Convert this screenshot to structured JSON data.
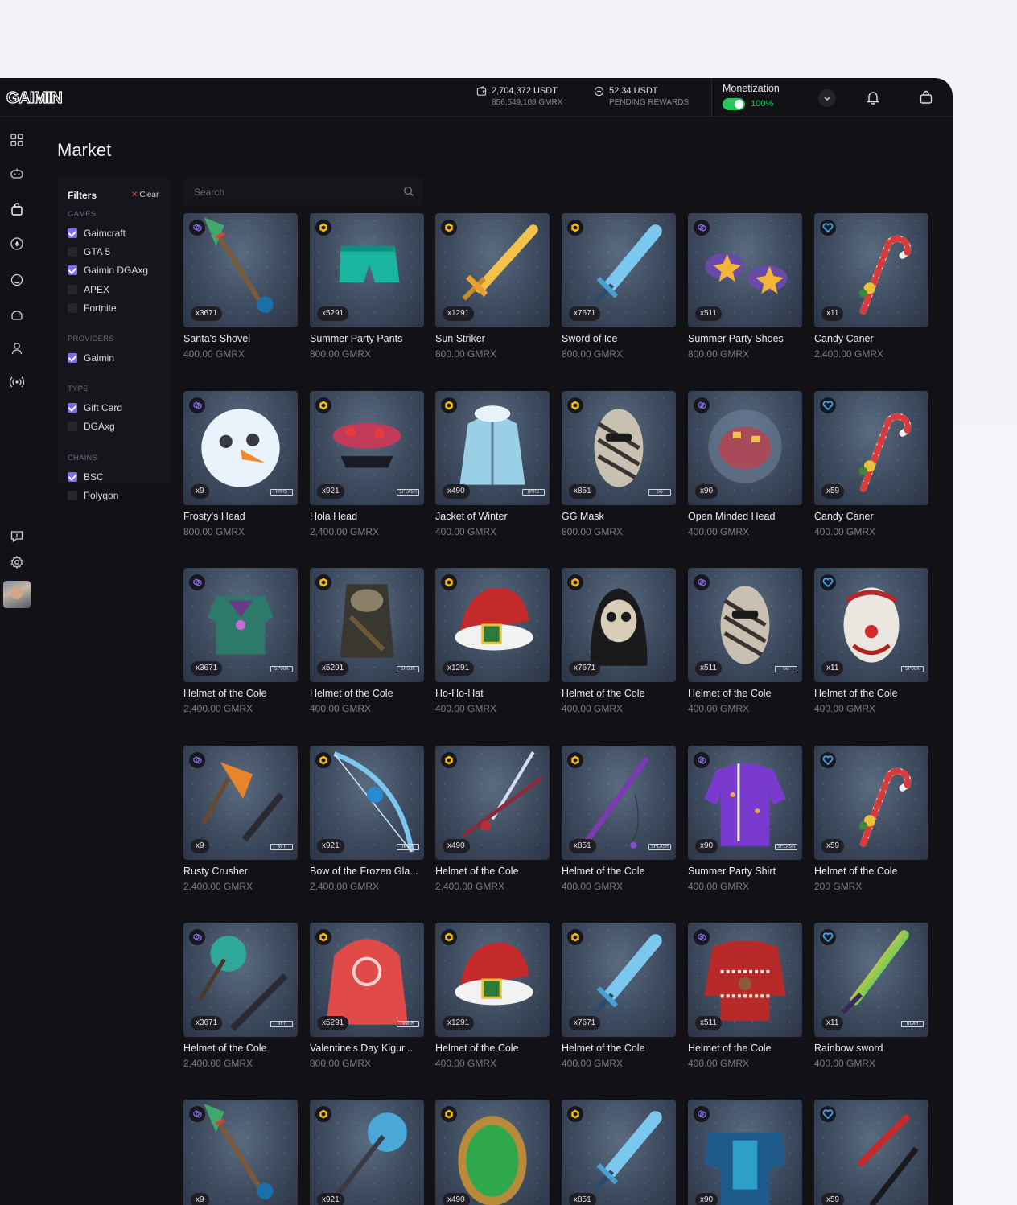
{
  "app": {
    "logo_text": "GAIMIN",
    "brand_color": "#7c6cf0"
  },
  "header": {
    "balance_usdt": "2,704,372 USDT",
    "balance_gmrx": "856,549,108 GMRX",
    "rewards_usdt": "52.34 USDT",
    "rewards_label": "PENDING REWARDS",
    "monetization_label": "Monetization",
    "monetization_pct": "100%",
    "monetization_on": true
  },
  "page": {
    "title": "Market"
  },
  "filters": {
    "title": "Filters",
    "clear": "Clear",
    "groups": [
      {
        "label": "GAMES",
        "options": [
          {
            "label": "Gaimcraft",
            "checked": true
          },
          {
            "label": "GTA 5",
            "checked": false
          },
          {
            "label": "Gaimin DGAxg",
            "checked": true
          },
          {
            "label": "APEX",
            "checked": false
          },
          {
            "label": "Fortnite",
            "checked": false
          }
        ]
      },
      {
        "label": "PROVIDERS",
        "options": [
          {
            "label": "Gaimin",
            "checked": true
          }
        ]
      },
      {
        "label": "TYPE",
        "options": [
          {
            "label": "Gift Card",
            "checked": true
          },
          {
            "label": "DGAxg",
            "checked": false
          }
        ]
      },
      {
        "label": "CHAINS",
        "options": [
          {
            "label": "BSC",
            "checked": true
          },
          {
            "label": "Polygon",
            "checked": false
          }
        ]
      }
    ]
  },
  "search": {
    "placeholder": "Search"
  },
  "items": [
    {
      "name": "Santa's Shovel",
      "price": "400.00 GMRX",
      "qty": "x3671",
      "chain": "polygon",
      "art": "shovel",
      "tag": ""
    },
    {
      "name": "Summer Party Pants",
      "price": "800.00 GMRX",
      "qty": "x5291",
      "chain": "bsc",
      "art": "shorts",
      "tag": ""
    },
    {
      "name": "Sun Striker",
      "price": "800.00 GMRX",
      "qty": "x1291",
      "chain": "bsc",
      "art": "goldsword",
      "tag": ""
    },
    {
      "name": "Sword of Ice",
      "price": "800.00 GMRX",
      "qty": "x7671",
      "chain": "bsc",
      "art": "icesword",
      "tag": ""
    },
    {
      "name": "Summer Party Shoes",
      "price": "800.00 GMRX",
      "qty": "x511",
      "chain": "polygon",
      "art": "shoes",
      "tag": ""
    },
    {
      "name": "Candy Caner",
      "price": "2,400.00 GMRX",
      "qty": "x11",
      "chain": "eth",
      "art": "candy",
      "tag": ""
    },
    {
      "name": "Frosty's Head",
      "price": "800.00 GMRX",
      "qty": "x9",
      "chain": "polygon",
      "art": "snowman",
      "tag": "HMRS"
    },
    {
      "name": "Hola Head",
      "price": "2,400.00 GMRX",
      "qty": "x921",
      "chain": "bsc",
      "art": "hola",
      "tag": "SPLASH"
    },
    {
      "name": "Jacket of Winter",
      "price": "400.00 GMRX",
      "qty": "x490",
      "chain": "bsc",
      "art": "jacket",
      "tag": "HMRS"
    },
    {
      "name": "GG Mask",
      "price": "800.00 GMRX",
      "qty": "x851",
      "chain": "bsc",
      "art": "mask",
      "tag": "GG"
    },
    {
      "name": "Open Minded Head",
      "price": "400.00 GMRX",
      "qty": "x90",
      "chain": "polygon",
      "art": "brain",
      "tag": ""
    },
    {
      "name": "Candy Caner",
      "price": "400.00 GMRX",
      "qty": "x59",
      "chain": "eth",
      "art": "candy",
      "tag": ""
    },
    {
      "name": "Helmet of the Cole",
      "price": "2,400.00 GMRX",
      "qty": "x3671",
      "chain": "polygon",
      "art": "armor",
      "tag": "SPOOK"
    },
    {
      "name": "Helmet of the Cole",
      "price": "400.00 GMRX",
      "qty": "x5291",
      "chain": "bsc",
      "art": "scarecrow",
      "tag": "SPOOK"
    },
    {
      "name": "Ho-Ho-Hat",
      "price": "400.00 GMRX",
      "qty": "x1291",
      "chain": "bsc",
      "art": "santahat",
      "tag": ""
    },
    {
      "name": "Helmet of the Cole",
      "price": "400.00 GMRX",
      "qty": "x7671",
      "chain": "bsc",
      "art": "skull",
      "tag": ""
    },
    {
      "name": "Helmet of the Cole",
      "price": "400.00 GMRX",
      "qty": "x511",
      "chain": "polygon",
      "art": "mask",
      "tag": "GG"
    },
    {
      "name": "Helmet of the Cole",
      "price": "400.00 GMRX",
      "qty": "x11",
      "chain": "eth",
      "art": "clown",
      "tag": "SPOOK"
    },
    {
      "name": "Rusty Crusher",
      "price": "2,400.00 GMRX",
      "qty": "x9",
      "chain": "polygon",
      "art": "axegun",
      "tag": "NFT"
    },
    {
      "name": "Bow of the Frozen Gla...",
      "price": "2,400.00 GMRX",
      "qty": "x921",
      "chain": "bsc",
      "art": "bow",
      "tag": "HMRS"
    },
    {
      "name": "Helmet of the Cole",
      "price": "2,400.00 GMRX",
      "qty": "x490",
      "chain": "bsc",
      "art": "katana",
      "tag": ""
    },
    {
      "name": "Helmet of the Cole",
      "price": "400.00 GMRX",
      "qty": "x851",
      "chain": "bsc",
      "art": "staff",
      "tag": "SPLASH"
    },
    {
      "name": "Summer Party Shirt",
      "price": "400.00 GMRX",
      "qty": "x90",
      "chain": "polygon",
      "art": "shirt",
      "tag": "SPLASH"
    },
    {
      "name": "Helmet of the Cole",
      "price": "200 GMRX",
      "qty": "x59",
      "chain": "eth",
      "art": "candy",
      "tag": ""
    },
    {
      "name": "Helmet of the Cole",
      "price": "2,400.00 GMRX",
      "qty": "x3671",
      "chain": "polygon",
      "art": "axegun2",
      "tag": "NFT"
    },
    {
      "name": "Valentine's Day Kigur...",
      "price": "800.00 GMRX",
      "qty": "x5291",
      "chain": "bsc",
      "art": "hoodie",
      "tag": "VORM"
    },
    {
      "name": "Helmet of the Cole",
      "price": "400.00 GMRX",
      "qty": "x1291",
      "chain": "bsc",
      "art": "santahat",
      "tag": ""
    },
    {
      "name": "Helmet of the Cole",
      "price": "400.00 GMRX",
      "qty": "x7671",
      "chain": "bsc",
      "art": "icesword",
      "tag": ""
    },
    {
      "name": "Helmet of the Cole",
      "price": "400.00 GMRX",
      "qty": "x511",
      "chain": "polygon",
      "art": "sweater",
      "tag": ""
    },
    {
      "name": "Rainbow sword",
      "price": "400.00 GMRX",
      "qty": "x11",
      "chain": "eth",
      "art": "rainbow",
      "tag": "BLAH"
    },
    {
      "name": "",
      "price": "",
      "qty": "x9",
      "chain": "polygon",
      "art": "shovel",
      "tag": ""
    },
    {
      "name": "",
      "price": "",
      "qty": "x921",
      "chain": "bsc",
      "art": "iceaxe",
      "tag": ""
    },
    {
      "name": "",
      "price": "",
      "qty": "x490",
      "chain": "bsc",
      "art": "shield",
      "tag": ""
    },
    {
      "name": "",
      "price": "",
      "qty": "x851",
      "chain": "bsc",
      "art": "icesword",
      "tag": ""
    },
    {
      "name": "",
      "price": "",
      "qty": "x90",
      "chain": "polygon",
      "art": "bluearmor",
      "tag": ""
    },
    {
      "name": "",
      "price": "",
      "qty": "x59",
      "chain": "eth",
      "art": "redswords",
      "tag": ""
    }
  ]
}
